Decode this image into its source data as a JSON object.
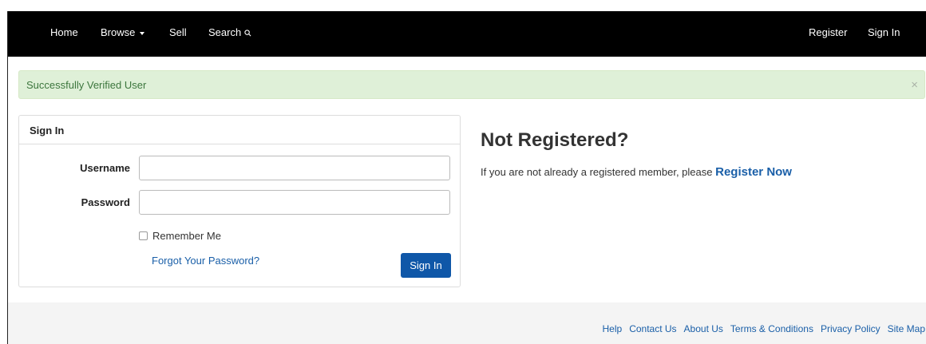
{
  "nav": {
    "home": "Home",
    "browse": "Browse",
    "sell": "Sell",
    "search": "Search",
    "register": "Register",
    "sign_in": "Sign In"
  },
  "alert": {
    "message": "Successfully Verified User",
    "close": "×"
  },
  "signin_panel": {
    "title": "Sign In",
    "username_label": "Username",
    "username_value": "",
    "password_label": "Password",
    "password_value": "",
    "remember_label": "Remember Me",
    "remember_checked": false,
    "forgot_link": "Forgot Your Password?",
    "submit": "Sign In"
  },
  "register_section": {
    "heading": "Not Registered?",
    "text": "If you are not already a registered member, please",
    "link": "Register Now"
  },
  "footer": {
    "links": [
      "Help",
      "Contact Us",
      "About Us",
      "Terms & Conditions",
      "Privacy Policy",
      "Site Map"
    ]
  },
  "colors": {
    "navbar_bg": "#000000",
    "alert_bg": "#dff0d8",
    "alert_text": "#3c763d",
    "link": "#1a5fa8",
    "button_bg": "#0f57a8",
    "footer_bg": "#f4f4f4"
  }
}
